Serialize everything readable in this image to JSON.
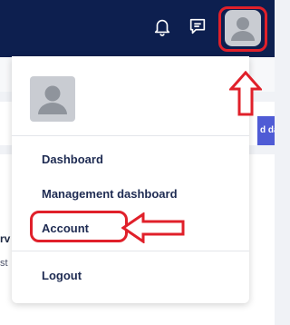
{
  "topbar": {
    "icons": [
      "bell-icon",
      "chat-icon",
      "user-avatar-icon"
    ],
    "background_color": "#0d1f4f"
  },
  "background": {
    "button_label": "d da",
    "text_fragment_1": "rv",
    "text_fragment_2": "st"
  },
  "menu": {
    "items": [
      {
        "label": "Dashboard"
      },
      {
        "label": "Management dashboard"
      },
      {
        "label": "Account"
      },
      {
        "label": "Logout"
      }
    ]
  },
  "annotations": {
    "highlight_color": "#e0202a"
  }
}
